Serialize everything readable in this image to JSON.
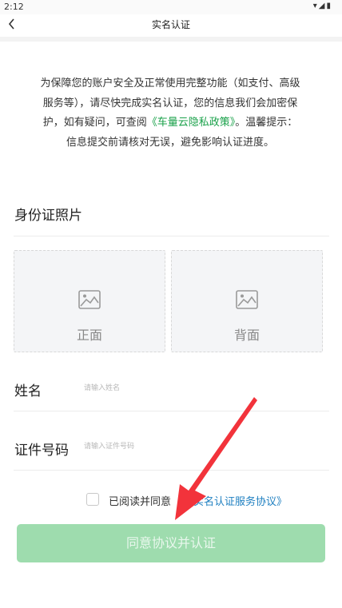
{
  "status_bar": {
    "time": "2:12",
    "icons": [
      "wifi-icon",
      "signal-icon",
      "battery-icon"
    ]
  },
  "nav": {
    "title": "实名认证",
    "back_icon": "chevron-left-icon"
  },
  "notice": {
    "text_before": "为保障您的账户安全及正常使用完整功能（如支付、高级服务等），请尽快完成实名认证，您的信息我们会加密保护，如有疑问，可查阅",
    "link": "《车量云隐私政策》",
    "text_after": "。温馨提示：信息提交前请核对无误，避免影响认证进度。"
  },
  "id_photo": {
    "title": "身份证照片",
    "front_label": "正面",
    "back_label": "背面",
    "icon": "image-icon"
  },
  "form": {
    "name_label": "姓名",
    "name_placeholder": "请输入姓名",
    "name_value": "",
    "id_label": "证件号码",
    "id_placeholder": "请输入证件号码",
    "id_value": ""
  },
  "agreement": {
    "checked": false,
    "prefix": "已阅读并同意",
    "protocol": "《实名认证服务协议》"
  },
  "submit": {
    "label": "同意协议并认证",
    "color": "#9edcae"
  },
  "annotation": {
    "arrow_color": "#f2333b"
  }
}
